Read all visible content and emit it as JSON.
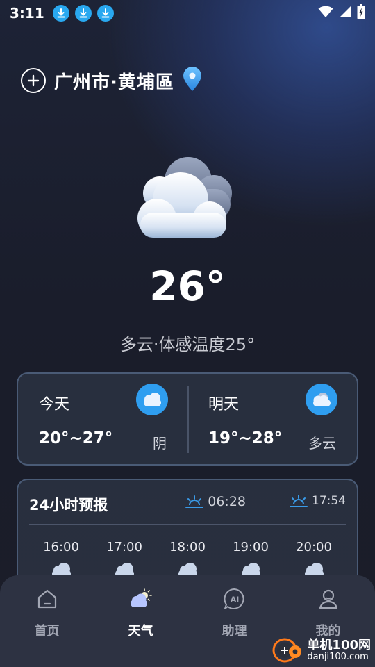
{
  "status_bar": {
    "time": "3:11"
  },
  "location": {
    "city": "广州市·黄埔區"
  },
  "current": {
    "temperature": "26°",
    "description": "多云·体感温度25°"
  },
  "daily": [
    {
      "label": "今天",
      "range": "20°~27°",
      "condition": "阴"
    },
    {
      "label": "明天",
      "range": "19°~28°",
      "condition": "多云"
    }
  ],
  "hourly": {
    "title": "24小时预报",
    "sunrise": "06:28",
    "sunset": "17:54",
    "times": [
      "16:00",
      "17:00",
      "18:00",
      "19:00",
      "20:00"
    ]
  },
  "tabs": [
    {
      "label": "首页",
      "icon": "home-icon"
    },
    {
      "label": "天气",
      "icon": "weather-icon"
    },
    {
      "label": "助理",
      "icon": "ai-assistant-icon"
    },
    {
      "label": "我的",
      "icon": "profile-icon"
    }
  ],
  "watermark": {
    "title": "单机100网",
    "url": "danji100.com"
  },
  "colors": {
    "accent": "#2f9ef0",
    "download_badge": "#29a8f0",
    "tabbar_bg": "#2d3242"
  }
}
